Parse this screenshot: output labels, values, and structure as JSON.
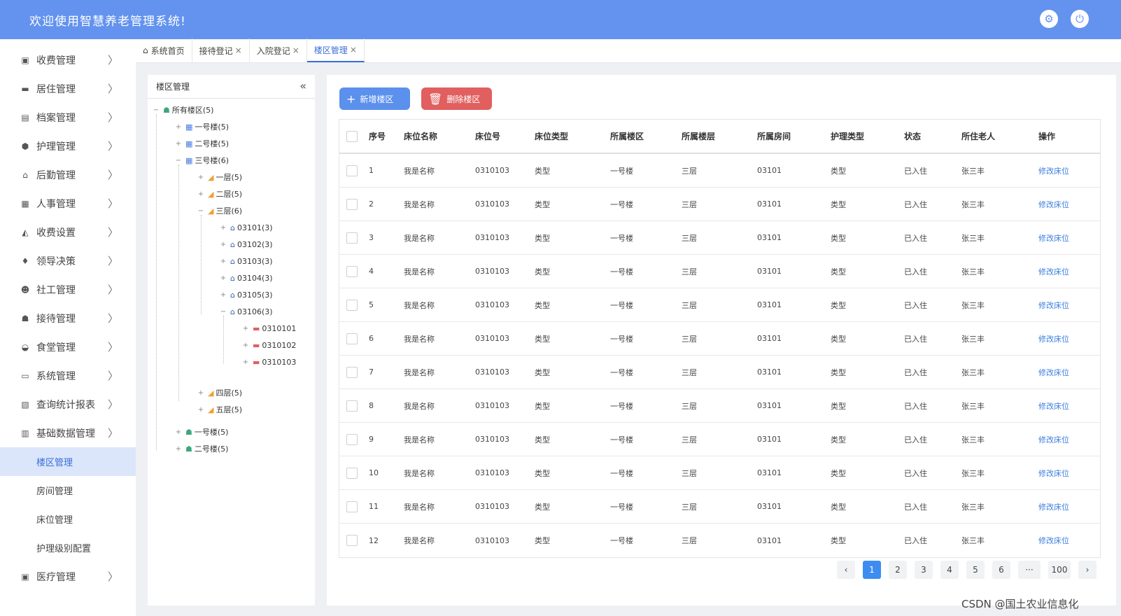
{
  "header": {
    "title": "欢迎使用智慧养老管理系统!",
    "settings_icon": "⚙",
    "power_icon": "⏻"
  },
  "sidebar": {
    "items": [
      {
        "label": "收费管理",
        "icon": "▣"
      },
      {
        "label": "居住管理",
        "icon": "▬"
      },
      {
        "label": "档案管理",
        "icon": "▤"
      },
      {
        "label": "护理管理",
        "icon": "⬢"
      },
      {
        "label": "后勤管理",
        "icon": "⌂"
      },
      {
        "label": "人事管理",
        "icon": "▦"
      },
      {
        "label": "收费设置",
        "icon": "◭"
      },
      {
        "label": "领导决策",
        "icon": "♦"
      },
      {
        "label": "社工管理",
        "icon": "☻"
      },
      {
        "label": "接待管理",
        "icon": "☗"
      },
      {
        "label": "食堂管理",
        "icon": "◒"
      },
      {
        "label": "系统管理",
        "icon": "▭"
      },
      {
        "label": "查询统计报表",
        "icon": "▧"
      },
      {
        "label": "基础数据管理",
        "icon": "▥"
      }
    ],
    "sub_items": [
      {
        "label": "楼区管理",
        "active": true
      },
      {
        "label": "房间管理"
      },
      {
        "label": "床位管理"
      },
      {
        "label": "护理级别配置"
      }
    ],
    "last_item": {
      "label": "医疗管理",
      "icon": "▣"
    },
    "chevron": "〉"
  },
  "tabs": [
    {
      "label": "系统首页",
      "icon": "⌂"
    },
    {
      "label": "接待登记",
      "close": "×"
    },
    {
      "label": "入院登记",
      "close": "×"
    },
    {
      "label": "楼区管理",
      "close": "×",
      "active": true
    }
  ],
  "tree": {
    "title": "楼区管理",
    "collapse_icon": "«",
    "nodes": [
      {
        "label": "所有楼区(5)",
        "toggle": "−",
        "icon": "☗",
        "type": "build"
      },
      {
        "label": "一号楼(5)",
        "toggle": "+",
        "icon": "▦",
        "type": "blue"
      },
      {
        "label": "二号楼(5)",
        "toggle": "+",
        "icon": "▦",
        "type": "blue"
      },
      {
        "label": "三号楼(6)",
        "toggle": "−",
        "icon": "▦",
        "type": "blue"
      },
      {
        "label": "一层(5)",
        "toggle": "+",
        "icon": "◢",
        "type": "floor"
      },
      {
        "label": "二层(5)",
        "toggle": "+",
        "icon": "◢",
        "type": "floor"
      },
      {
        "label": "三层(6)",
        "toggle": "−",
        "icon": "◢",
        "type": "floor"
      },
      {
        "label": "03101(3)",
        "toggle": "+",
        "icon": "⌂",
        "type": "home"
      },
      {
        "label": "03102(3)",
        "toggle": "+",
        "icon": "⌂",
        "type": "home"
      },
      {
        "label": "03103(3)",
        "toggle": "+",
        "icon": "⌂",
        "type": "home"
      },
      {
        "label": "03104(3)",
        "toggle": "+",
        "icon": "⌂",
        "type": "home"
      },
      {
        "label": "03105(3)",
        "toggle": "+",
        "icon": "⌂",
        "type": "home"
      },
      {
        "label": "03106(3)",
        "toggle": "−",
        "icon": "⌂",
        "type": "home"
      },
      {
        "label": "0310101",
        "toggle": "+",
        "icon": "▬",
        "type": "bed"
      },
      {
        "label": "0310102",
        "toggle": "+",
        "icon": "▬",
        "type": "bed"
      },
      {
        "label": "0310103",
        "toggle": "+",
        "icon": "▬",
        "type": "bed"
      },
      {
        "label": "四层(5)",
        "toggle": "+",
        "icon": "◢",
        "type": "floor"
      },
      {
        "label": "五层(5)",
        "toggle": "+",
        "icon": "◢",
        "type": "floor"
      },
      {
        "label": "一号楼(5)",
        "toggle": "+",
        "icon": "☗",
        "type": "build"
      },
      {
        "label": "二号楼(5)",
        "toggle": "+",
        "icon": "☗",
        "type": "build"
      }
    ]
  },
  "toolbar": {
    "add_label": "新增楼区",
    "add_icon": "+",
    "delete_label": "删除楼区",
    "delete_icon": "🗑"
  },
  "table": {
    "headers": [
      "序号",
      "床位名称",
      "床位号",
      "床位类型",
      "所属楼区",
      "所属楼层",
      "所属房间",
      "护理类型",
      "状态",
      "所住老人",
      "操作"
    ],
    "rows": [
      [
        "1",
        "我是名称",
        "0310103",
        "类型",
        "一号楼",
        "三层",
        "03101",
        "类型",
        "已入住",
        "张三丰",
        "修改床位"
      ],
      [
        "2",
        "我是名称",
        "0310103",
        "类型",
        "一号楼",
        "三层",
        "03101",
        "类型",
        "已入住",
        "张三丰",
        "修改床位"
      ],
      [
        "3",
        "我是名称",
        "0310103",
        "类型",
        "一号楼",
        "三层",
        "03101",
        "类型",
        "已入住",
        "张三丰",
        "修改床位"
      ],
      [
        "4",
        "我是名称",
        "0310103",
        "类型",
        "一号楼",
        "三层",
        "03101",
        "类型",
        "已入住",
        "张三丰",
        "修改床位"
      ],
      [
        "5",
        "我是名称",
        "0310103",
        "类型",
        "一号楼",
        "三层",
        "03101",
        "类型",
        "已入住",
        "张三丰",
        "修改床位"
      ],
      [
        "6",
        "我是名称",
        "0310103",
        "类型",
        "一号楼",
        "三层",
        "03101",
        "类型",
        "已入住",
        "张三丰",
        "修改床位"
      ],
      [
        "7",
        "我是名称",
        "0310103",
        "类型",
        "一号楼",
        "三层",
        "03101",
        "类型",
        "已入住",
        "张三丰",
        "修改床位"
      ],
      [
        "8",
        "我是名称",
        "0310103",
        "类型",
        "一号楼",
        "三层",
        "03101",
        "类型",
        "已入住",
        "张三丰",
        "修改床位"
      ],
      [
        "9",
        "我是名称",
        "0310103",
        "类型",
        "一号楼",
        "三层",
        "03101",
        "类型",
        "已入住",
        "张三丰",
        "修改床位"
      ],
      [
        "10",
        "我是名称",
        "0310103",
        "类型",
        "一号楼",
        "三层",
        "03101",
        "类型",
        "已入住",
        "张三丰",
        "修改床位"
      ],
      [
        "11",
        "我是名称",
        "0310103",
        "类型",
        "一号楼",
        "三层",
        "03101",
        "类型",
        "已入住",
        "张三丰",
        "修改床位"
      ],
      [
        "12",
        "我是名称",
        "0310103",
        "类型",
        "一号楼",
        "三层",
        "03101",
        "类型",
        "已入住",
        "张三丰",
        "修改床位"
      ]
    ]
  },
  "pagination": {
    "prev": "‹",
    "pages": [
      "1",
      "2",
      "3",
      "4",
      "5",
      "6",
      "···",
      "100"
    ],
    "current": "1",
    "next": "›"
  },
  "watermark": "CSDN @国土农业信息化"
}
